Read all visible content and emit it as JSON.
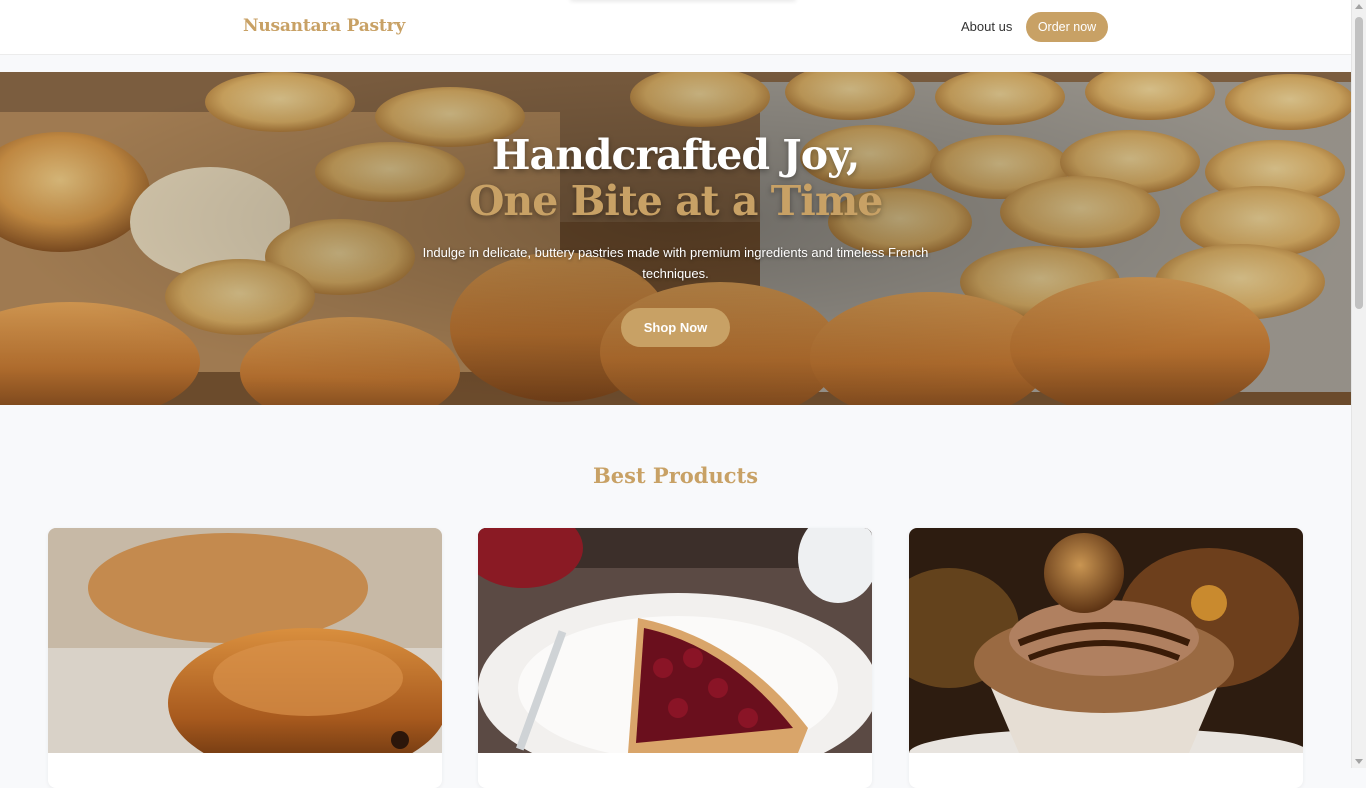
{
  "header": {
    "brand": "Nusantara Pastry",
    "nav_about": "About us",
    "order_label": "Order now"
  },
  "hero": {
    "title_line1": "Handcrafted Joy,",
    "title_line2": "One Bite at a Time",
    "subtitle": "Indulge in delicate, buttery pastries made with premium ingredients and timeless French techniques.",
    "cta_label": "Shop Now",
    "image": "bakery-tray-pastries-photo"
  },
  "products": {
    "title": "Best Products",
    "items": [
      {
        "image": "pain-au-chocolat-photo"
      },
      {
        "image": "cherry-tart-slice-photo"
      },
      {
        "image": "chocolate-hazelnut-cupcake-photo"
      }
    ]
  },
  "colors": {
    "accent": "#c8a165",
    "background": "#f8f9fb",
    "header_bg": "#ffffff"
  }
}
